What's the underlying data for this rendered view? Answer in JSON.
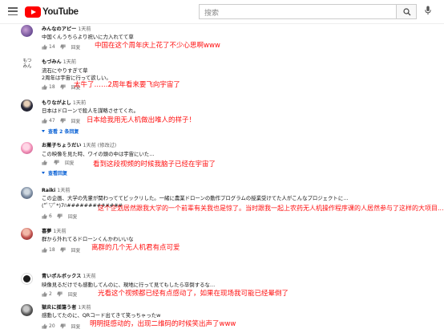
{
  "header": {
    "logo_text": "YouTube",
    "search_placeholder": "搜索"
  },
  "comments": [
    {
      "author": "みんなのアピー",
      "time": "1天前",
      "lines": [
        "中国くんうちらより祝いに力入れてて草"
      ],
      "likes": "14",
      "reply_label": "回复",
      "annotation": "中国在这个周年庆上花了不少心思啊www"
    },
    {
      "author": "もづみん",
      "time": "1天前",
      "lines": [
        "流石にやりすぎて草",
        "2周年は宇宙に行って欲しい。"
      ],
      "likes": "18",
      "reply_label": "回复",
      "annotation": "太牛了……2周年看来要飞向宇宙了",
      "avatar_text": "もづみん"
    },
    {
      "author": "もりながよし",
      "time": "1天前",
      "lines": [
        "日本はドローンで殺人を謀略させてくれ。"
      ],
      "likes": "47",
      "reply_label": "回复",
      "replies_label": "查看 2 条回复",
      "annotation": "日本给我用无人机做出唯人的样子！"
    },
    {
      "author": "お菓子ちょうだい",
      "time": "1天前 (修改过)",
      "lines": [
        "この映像を見た時、ワイの頭の中は宇宙にいた…"
      ],
      "likes": "",
      "reply_label": "回复",
      "replies_label": "查看回复",
      "annotation": "看到这段视频的时候我脑子已经在宇宙了"
    },
    {
      "author": "Raiki",
      "time": "1天前",
      "lines": [
        "この企画、大学の先輩が関わっててビックリした。一緒に農業ドローンの動作プログラムの授業受けてた人がこんなプロジェクトに…",
        "(*ﾟ▽ﾟ*)7ﾊ#############"
      ],
      "likes": "6",
      "reply_label": "回复",
      "annotation": "这个企划居然跟我大学的一个前辈有关我也是惊了。当时跟我一起上农药无人机操作程序课的人居然参与了这样的大项目..."
    },
    {
      "author": "喜夢",
      "time": "1天前",
      "lines": [
        "群から外れてるドローンくんかわいいな"
      ],
      "likes": "18",
      "reply_label": "回复",
      "annotation": "离群的几个无人机君有点可爱"
    },
    {
      "author": "青いポルボックス",
      "time": "1天前",
      "lines": [
        "映像見るだけでも感動してんのに、現地に行って見てもしたら卒倒するな…"
      ],
      "likes": "2",
      "reply_label": "回复",
      "annotation": "光看这个视频都已经有点感动了，如果在现场我可能已经晕倒了"
    },
    {
      "author": "獄炎に揺蕩う者",
      "time": "1天前",
      "lines": [
        "感動してたのに、QRコード出てきて笑っちゃったw"
      ],
      "likes": "20",
      "reply_label": "回复",
      "annotation": "明明挺感动的，出现二维码的时候笑出声了www"
    }
  ]
}
